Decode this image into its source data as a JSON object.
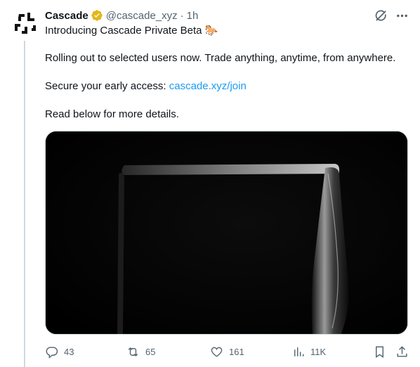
{
  "author": {
    "name": "Cascade",
    "handle": "@cascade_xyz",
    "separator": "·",
    "time": "1h"
  },
  "tweet": {
    "title": "Introducing Cascade Private Beta 🐎",
    "line2": "Rolling out to selected users now. Trade anything, anytime, from anywhere.",
    "line3_prefix": "Secure your early access: ",
    "line3_link": "cascade.xyz/join",
    "line4": "Read below for more details."
  },
  "stats": {
    "replies": "43",
    "retweets": "65",
    "likes": "161",
    "views": "11K"
  },
  "icons": {
    "verified": "verified-badge-icon",
    "grok": "grok-icon",
    "more": "more-icon",
    "reply": "reply-icon",
    "retweet": "retweet-icon",
    "like": "heart-icon",
    "views": "views-icon",
    "bookmark": "bookmark-icon",
    "share": "share-icon"
  },
  "colors": {
    "text": "#0f1419",
    "muted": "#536471",
    "link": "#1d9bf0",
    "verified": "#e2b719",
    "line": "#cfd9de"
  }
}
